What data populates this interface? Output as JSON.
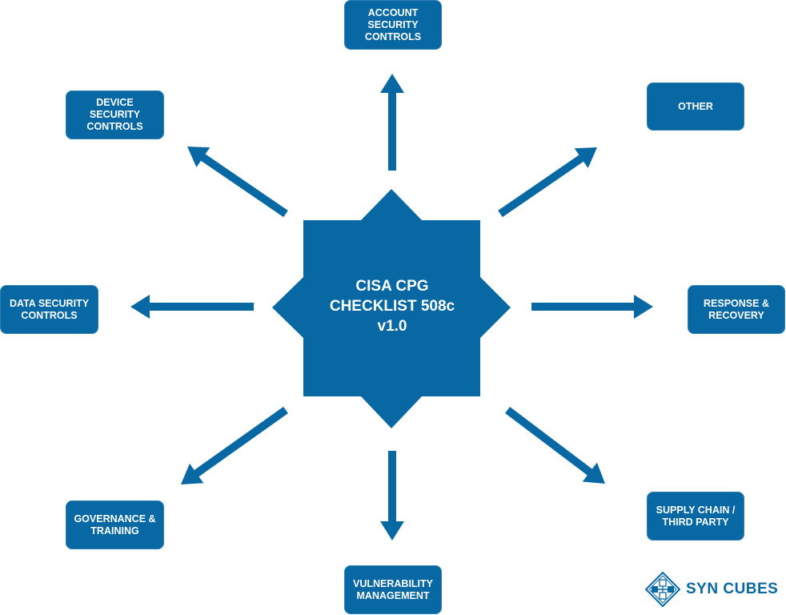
{
  "diagram": {
    "type": "hub-and-spoke",
    "colors": {
      "primary": "#0768a3",
      "border": "#2f7fb2",
      "text": "#ffffff",
      "background": "#ffffff"
    },
    "center": {
      "lines": [
        "CISA CPG",
        "CHECKLIST 508c",
        "v1.0"
      ]
    },
    "nodes": [
      {
        "id": "account-security-controls",
        "label": "ACCOUNT\nSECURITY\nCONTROLS",
        "direction": "north"
      },
      {
        "id": "other",
        "label": "OTHER",
        "direction": "north-east"
      },
      {
        "id": "response-recovery",
        "label": "RESPONSE &\nRECOVERY",
        "direction": "east"
      },
      {
        "id": "supply-chain-third-party",
        "label": "SUPPLY CHAIN /\nTHIRD PARTY",
        "direction": "south-east"
      },
      {
        "id": "vulnerability-management",
        "label": "VULNERABILITY\nMANAGEMENT",
        "direction": "south"
      },
      {
        "id": "governance-training",
        "label": "GOVERNANCE &\nTRAINING",
        "direction": "south-west"
      },
      {
        "id": "data-security-controls",
        "label": "DATA SECURITY\nCONTROLS",
        "direction": "west"
      },
      {
        "id": "device-security-controls",
        "label": "DEVICE\nSECURITY\nCONTROLS",
        "direction": "north-west"
      }
    ],
    "edges": [
      {
        "from": "center",
        "to": "account-security-controls"
      },
      {
        "from": "center",
        "to": "other"
      },
      {
        "from": "center",
        "to": "response-recovery"
      },
      {
        "from": "center",
        "to": "supply-chain-third-party"
      },
      {
        "from": "center",
        "to": "vulnerability-management"
      },
      {
        "from": "center",
        "to": "governance-training"
      },
      {
        "from": "center",
        "to": "data-security-controls"
      },
      {
        "from": "center",
        "to": "device-security-controls"
      }
    ]
  },
  "logo": {
    "text": "SYN CUBES",
    "icon": "syn-cubes-diamond-logo-icon"
  }
}
